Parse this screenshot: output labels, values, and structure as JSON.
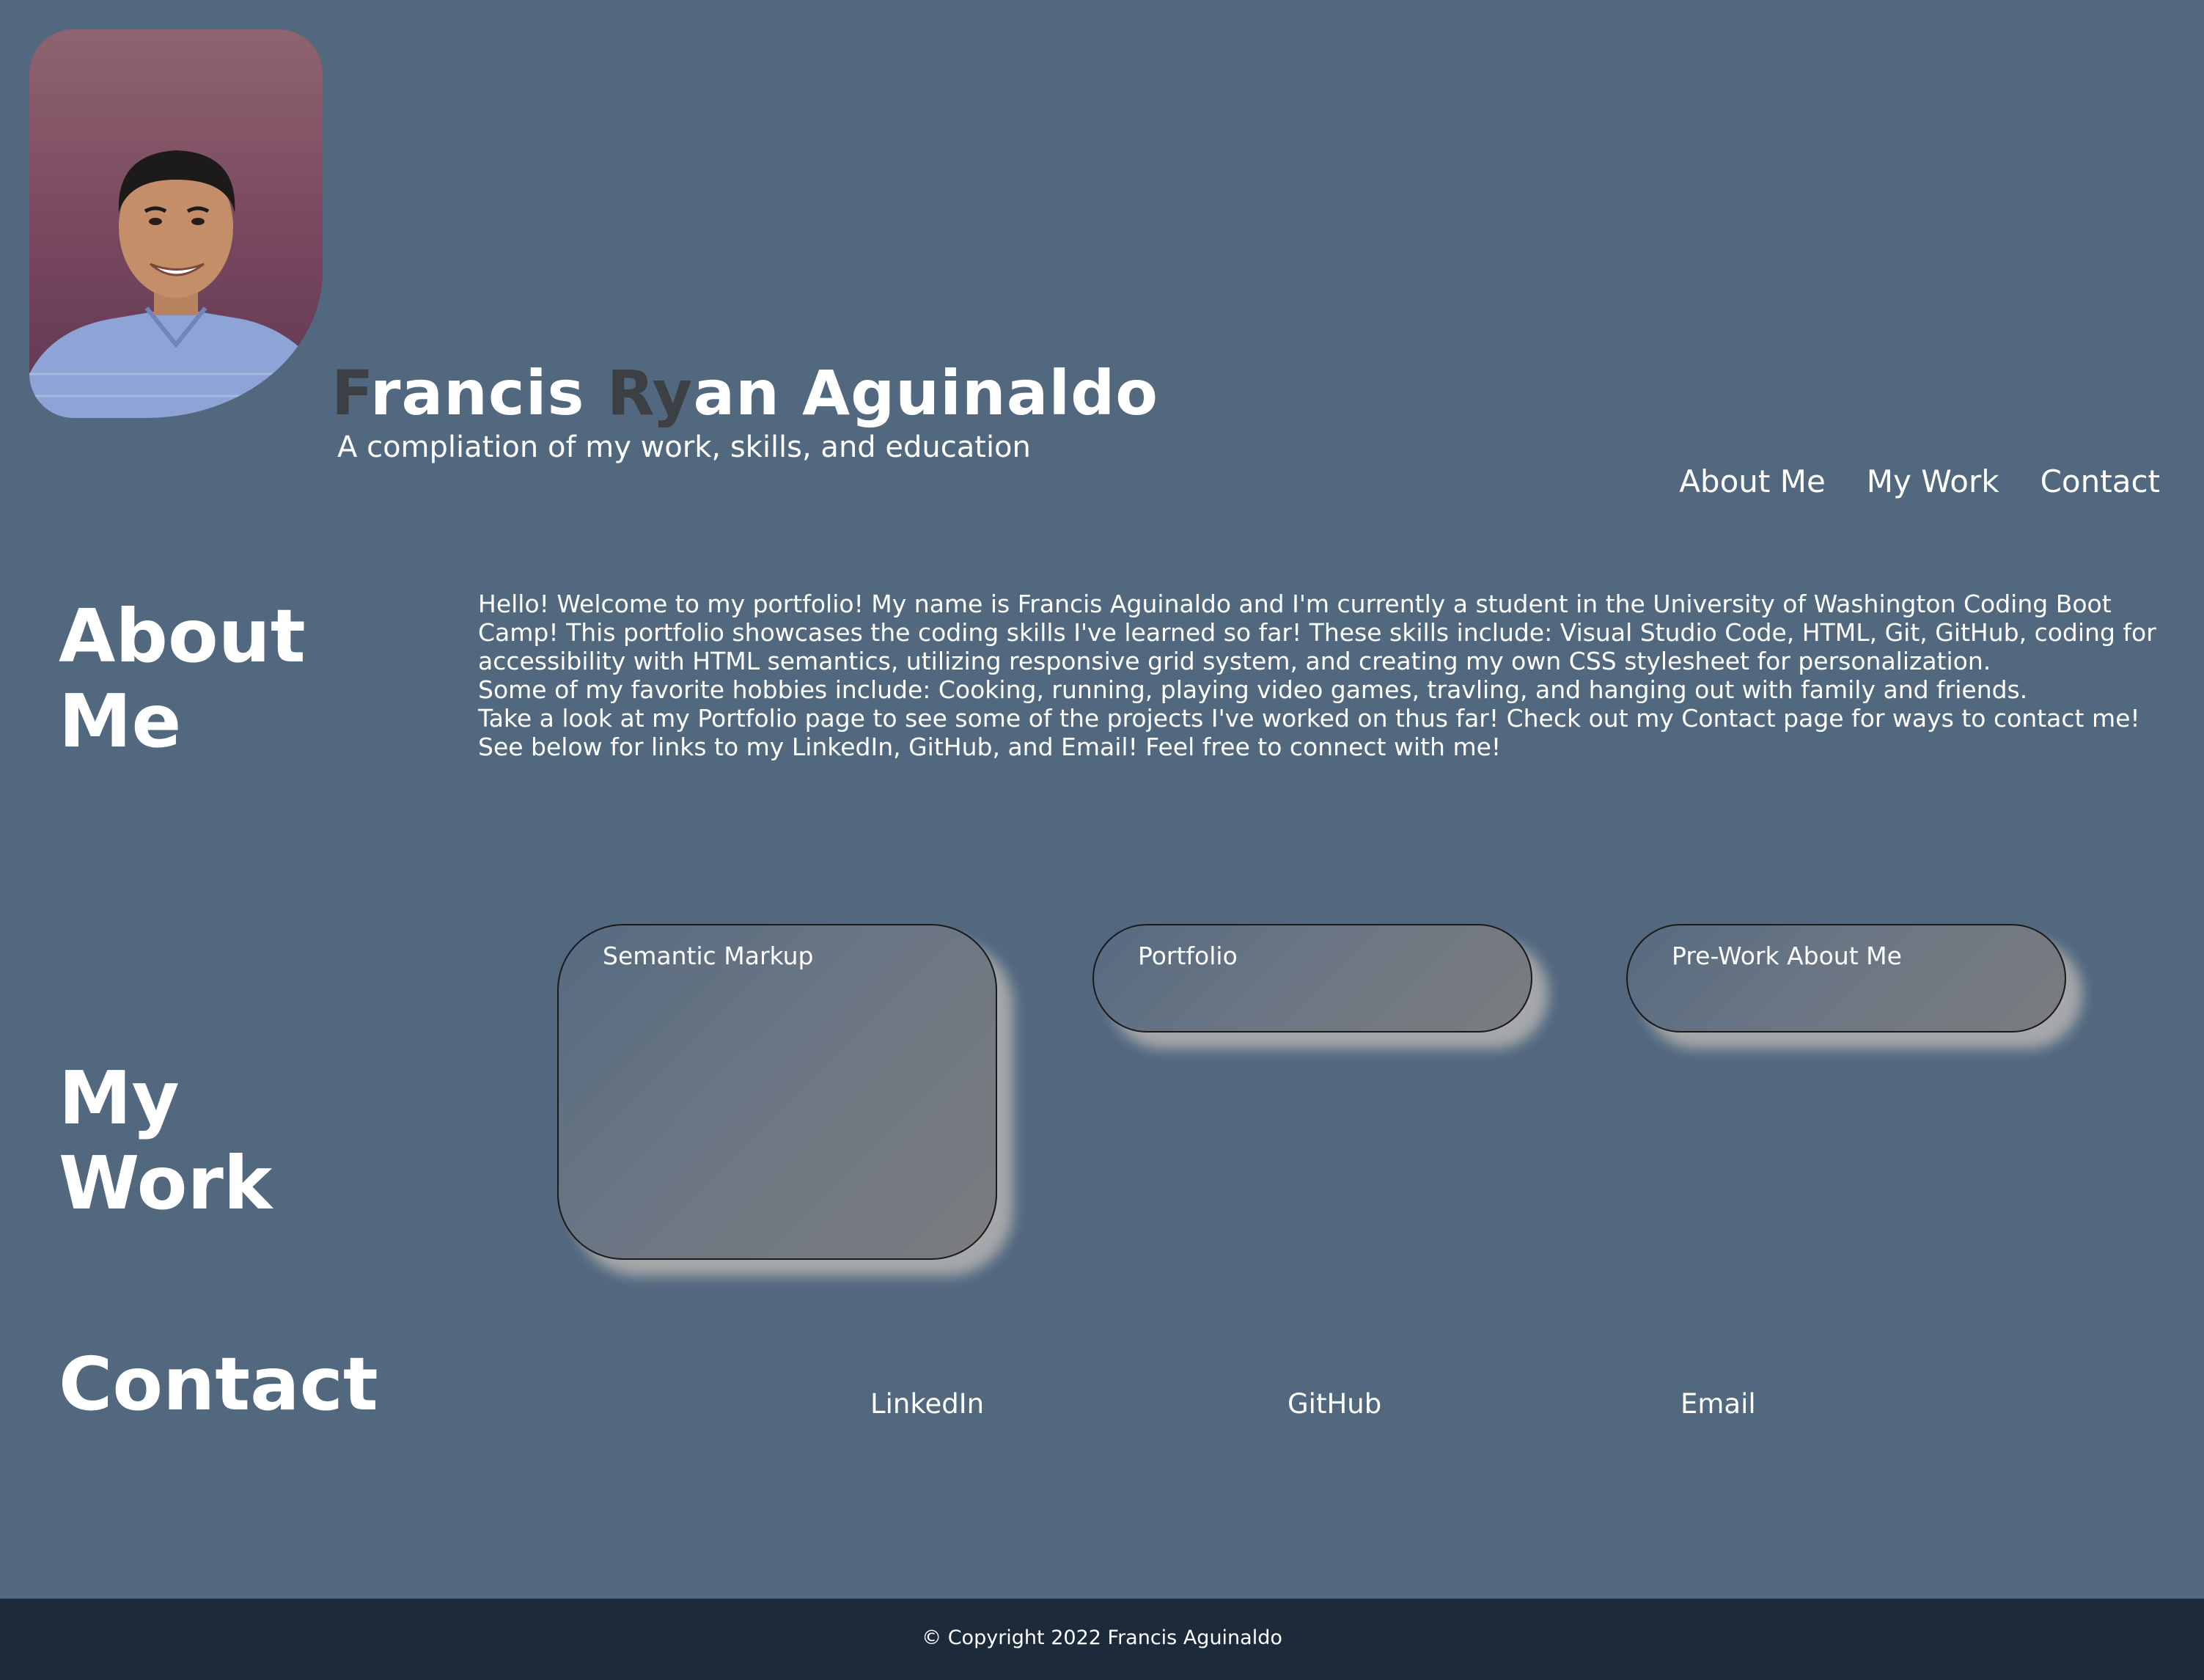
{
  "header": {
    "name_parts": [
      {
        "text": "F",
        "style": "dim"
      },
      {
        "text": "rancis ",
        "style": "normal"
      },
      {
        "text": "Ry",
        "style": "dim"
      },
      {
        "text": "an Aguinaldo",
        "style": "normal"
      }
    ],
    "tagline": "A compliation of my work, skills, and education"
  },
  "nav": {
    "items": [
      {
        "label": "About Me"
      },
      {
        "label": "My Work"
      },
      {
        "label": "Contact"
      }
    ]
  },
  "about": {
    "title": "About Me",
    "paragraphs": [
      "Hello! Welcome to my portfolio! My name is Francis Aguinaldo and I'm currently a student in the University of Washington Coding Boot Camp! This portfolio showcases the coding skills I've learned so far! These skills include: Visual Studio Code, HTML, Git, GitHub, coding for accessibility with HTML semantics, utilizing responsive grid system, and creating my own CSS stylesheet for personalization.",
      "Some of my favorite hobbies include: Cooking, running, playing video games, travling, and hanging out with family and friends.",
      "Take a look at my Portfolio page to see some of the projects I've worked on thus far! Check out my Contact page for ways to contact me!",
      "See below for links to my LinkedIn, GitHub, and Email! Feel free to connect with me!"
    ]
  },
  "work": {
    "title": "My Work",
    "cards": [
      {
        "label": "Semantic Markup"
      },
      {
        "label": "Portfolio"
      },
      {
        "label": "Pre-Work About Me"
      }
    ]
  },
  "contact": {
    "title": "Contact",
    "links": [
      {
        "label": "LinkedIn"
      },
      {
        "label": "GitHub"
      },
      {
        "label": "Email"
      }
    ]
  },
  "footer": {
    "copyright": "© Copyright 2022 Francis Aguinaldo"
  },
  "colors": {
    "page_background": "#52687f",
    "footer_background": "#1c2a3a",
    "name_highlight": "#3c3f44",
    "text": "#ffffff"
  }
}
